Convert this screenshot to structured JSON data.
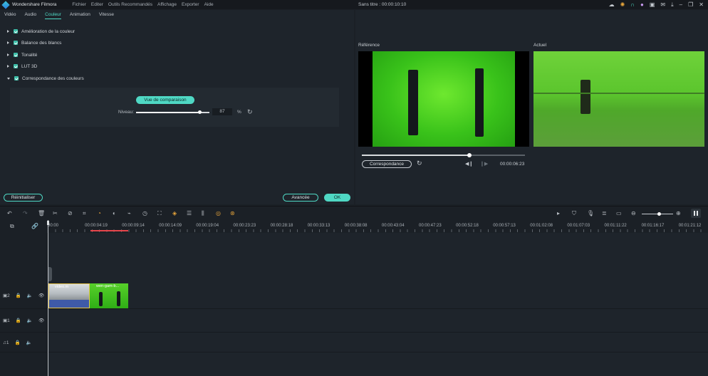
{
  "titlebar": {
    "app_name": "Wondershare Filmora",
    "menu": [
      "Fichier",
      "Editer",
      "Outils Recommandés",
      "Affichage",
      "Exporter",
      "Aide"
    ],
    "doc_title": "Sans titre : 00:00:10:10"
  },
  "editor": {
    "tabs": [
      "Vidéo",
      "Audio",
      "Couleur",
      "Animation",
      "Vitesse"
    ],
    "active_tab": "Couleur",
    "sections": [
      {
        "label": "Amélioration de la couleur",
        "checked": true,
        "expanded": false
      },
      {
        "label": "Balance des blancs",
        "checked": true,
        "expanded": false
      },
      {
        "label": "Tonalité",
        "checked": true,
        "expanded": false
      },
      {
        "label": "LUT 3D",
        "checked": true,
        "expanded": false
      },
      {
        "label": "Correspondance des couleurs",
        "checked": true,
        "expanded": true
      }
    ],
    "compare_button": "Vue de comparaison",
    "level_label": "Niveau:",
    "level_value": "87",
    "level_percent": 87,
    "level_unit": "%",
    "reset_all": "Réinitialiser",
    "advanced": "Avancée",
    "ok": "OK"
  },
  "preview": {
    "reference_label": "Référence",
    "current_label": "Actuel",
    "match_button": "Correspondance",
    "timecode": "00:00:06:23",
    "progress_fraction": 0.66
  },
  "timeline": {
    "ruler_labels": [
      "00:00",
      "00:00:04:19",
      "00:00:09:14",
      "00:00:14:09",
      "00:00:19:04",
      "00:00:23:23",
      "00:00:28:18",
      "00:00:33:13",
      "00:00:38:08",
      "00:00:43:04",
      "00:00:47:23",
      "00:00:52:18",
      "00:00:57:13",
      "00:01:02:08",
      "00:01:07:03",
      "00:01:11:22",
      "00:01:16:17",
      "00:01:21:12"
    ],
    "tracks": [
      {
        "number": "2",
        "kind": "video"
      },
      {
        "number": "1",
        "kind": "video"
      },
      {
        "number": "1",
        "kind": "audio"
      }
    ],
    "clips": [
      {
        "name": "video.m"
      },
      {
        "name": "wen-gam-b..."
      }
    ],
    "zoom_fraction": 0.55
  },
  "icons": {
    "toolbar": [
      "undo-icon",
      "redo-icon",
      "delete-icon",
      "cut-icon",
      "tag-icon",
      "crop-icon",
      "speed-icon",
      "color-icon",
      "stabilize-icon",
      "timer-icon",
      "fit-icon",
      "adjust-icon",
      "audio-mix-icon",
      "green-screen-icon",
      "keyframe-icon",
      "effect-icon"
    ],
    "accent_color": "#4fd8c4"
  }
}
